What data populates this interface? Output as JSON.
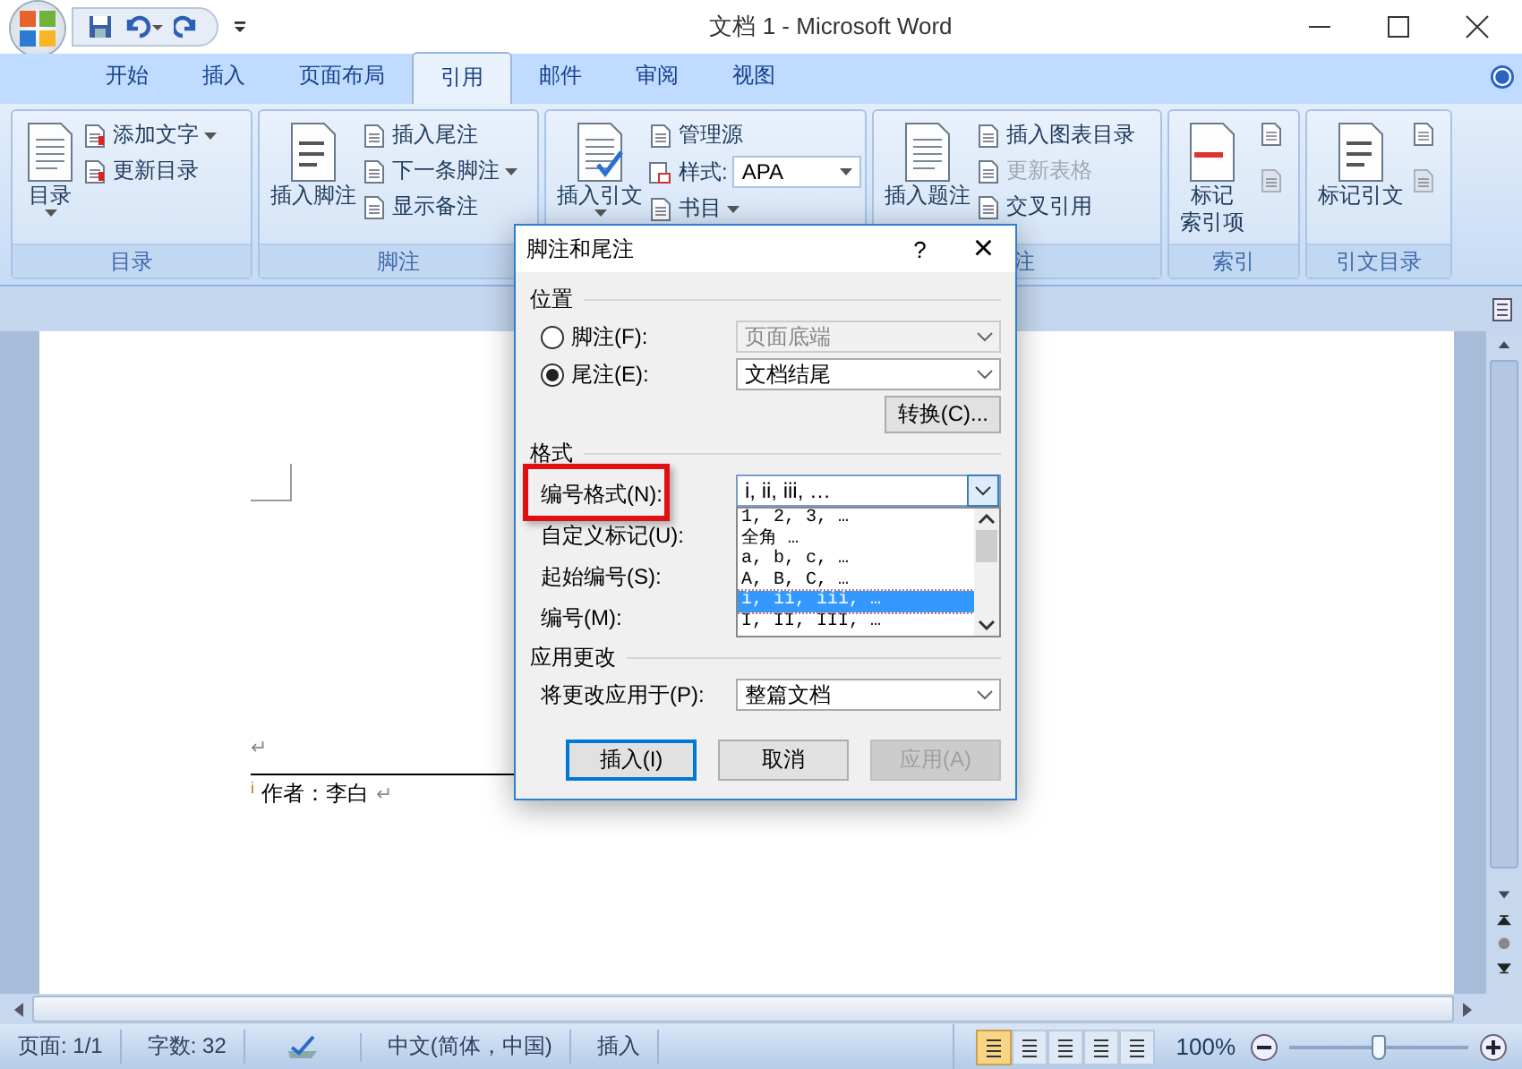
{
  "window": {
    "title": "文档 1 - Microsoft Word"
  },
  "tabs": [
    {
      "label": "开始",
      "selected": false
    },
    {
      "label": "插入",
      "selected": false
    },
    {
      "label": "页面布局",
      "selected": false
    },
    {
      "label": "引用",
      "selected": true
    },
    {
      "label": "邮件",
      "selected": false
    },
    {
      "label": "审阅",
      "selected": false
    },
    {
      "label": "视图",
      "selected": false
    }
  ],
  "ribbon_groups": [
    {
      "label": "目录",
      "large": {
        "label": "目录",
        "caret": true
      },
      "small": [
        {
          "kind": "button",
          "label": "添加文字",
          "caret": true,
          "disabled": false
        },
        {
          "kind": "button",
          "label": "更新目录",
          "caret": false,
          "disabled": false
        }
      ]
    },
    {
      "label": "脚注",
      "large": {
        "label": "插入脚注",
        "caret": false
      },
      "small": [
        {
          "kind": "button",
          "label": "插入尾注",
          "caret": false,
          "disabled": false
        },
        {
          "kind": "button",
          "label": "下一条脚注",
          "caret": true,
          "disabled": false
        },
        {
          "kind": "button",
          "label": "显示备注",
          "caret": false,
          "disabled": false
        }
      ]
    },
    {
      "large": {
        "label": "插入引文",
        "caret": true
      },
      "small": [
        {
          "kind": "button",
          "label": "管理源",
          "caret": false,
          "disabled": false
        },
        {
          "kind": "select",
          "label": "样式:",
          "value": "APA"
        },
        {
          "kind": "button",
          "label": "书目",
          "caret": true,
          "disabled": false
        }
      ]
    },
    {
      "label": "注",
      "large": {
        "label": "插入题注",
        "caret": false
      },
      "small": [
        {
          "kind": "button",
          "label": "插入图表目录",
          "caret": false,
          "disabled": false
        },
        {
          "kind": "button",
          "label": "更新表格",
          "caret": false,
          "disabled": true
        },
        {
          "kind": "button",
          "label": "交叉引用",
          "caret": false,
          "disabled": false
        }
      ]
    },
    {
      "label": "索引",
      "large": {
        "label": "标记",
        "label_line_2": "索引项",
        "caret": false
      },
      "small": [
        {
          "kind": "icon",
          "disabled": false
        },
        {
          "kind": "icon",
          "disabled": true
        }
      ]
    },
    {
      "label": "引文目录",
      "large": {
        "label": "标记引文",
        "caret": false
      },
      "small": [
        {
          "kind": "icon",
          "disabled": false
        },
        {
          "kind": "icon",
          "disabled": true
        }
      ]
    }
  ],
  "document": {
    "lines": [
      {
        "kind": "blank",
        "text": "↵"
      },
      {
        "kind": "separator"
      },
      {
        "kind": "note",
        "mark": "i",
        "text": "作者：李白",
        "end": "↵"
      }
    ]
  },
  "dialog": {
    "title": "脚注和尾注",
    "help": "?",
    "close": "×",
    "location": {
      "heading": "位置",
      "options": [
        {
          "label": "脚注(F):",
          "selected": false,
          "value": "页面底端",
          "disabled": true
        },
        {
          "label": "尾注(E):",
          "selected": true,
          "value": "文档结尾",
          "disabled": false
        }
      ],
      "convert": "转换(C)..."
    },
    "format": {
      "heading": "格式",
      "number_format": {
        "label": "编号格式(N):",
        "value": "i, ii, iii, …",
        "highlighted": true,
        "options": [
          {
            "label": "1, 2, 3, …",
            "selected": false
          },
          {
            "label": "全角 …",
            "selected": false
          },
          {
            "label": "a, b, c, …",
            "selected": false
          },
          {
            "label": "A, B, C, …",
            "selected": false
          },
          {
            "label": "i, ii, iii, …",
            "selected": true
          },
          {
            "label": "I, II, III, …",
            "selected": false
          }
        ]
      },
      "labels": [
        "自定义标记(U):",
        "起始编号(S):",
        "编号(M):"
      ]
    },
    "apply": {
      "heading": "应用更改",
      "label": "将更改应用于(P):",
      "value": "整篇文档"
    },
    "buttons": [
      {
        "label": "插入(I)",
        "default": true,
        "disabled": false
      },
      {
        "label": "取消",
        "default": false,
        "disabled": false
      },
      {
        "label": "应用(A)",
        "default": false,
        "disabled": true
      }
    ]
  },
  "status_bar": {
    "items": [
      {
        "kind": "text",
        "text": "页面: 1/1"
      },
      {
        "kind": "text",
        "text": "字数: 32"
      },
      {
        "kind": "icon"
      },
      {
        "kind": "text",
        "text": "中文(简体，中国)"
      },
      {
        "kind": "text",
        "text": "插入"
      }
    ],
    "views": [
      {
        "selected": true
      },
      {
        "selected": false
      },
      {
        "selected": false
      },
      {
        "selected": false
      },
      {
        "selected": false
      }
    ],
    "zoom": {
      "text": "100%",
      "level": 0.5
    }
  }
}
